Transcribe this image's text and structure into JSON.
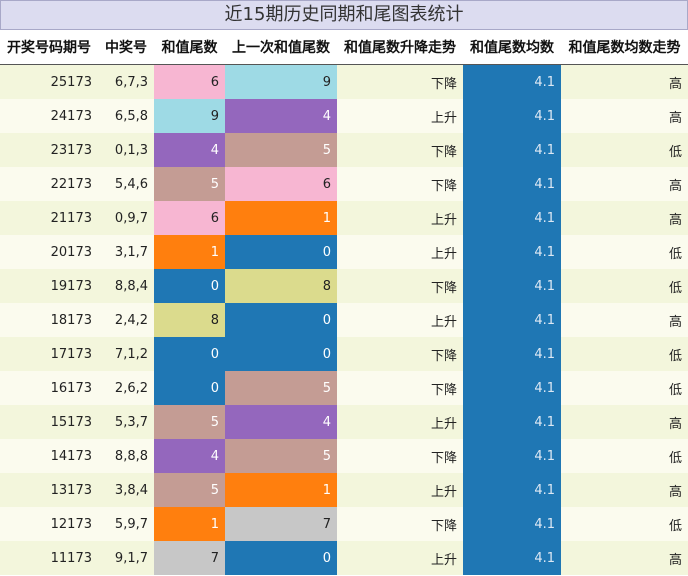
{
  "title": "近15期历史同期和尾图表统计",
  "headers": [
    "开奖号码期号",
    "中奖号",
    "和值尾数",
    "上一次和值尾数",
    "和值尾数升降走势",
    "和值尾数均数",
    "和值尾数均数走势"
  ],
  "colors": {
    "0": "#1f77b4",
    "1": "#ff7f0e",
    "4": "#9467bd",
    "5": "#c49c94",
    "6": "#f7b6d2",
    "7": "#c7c7c7",
    "8": "#dbdb8d",
    "9": "#9edae5",
    "avg": "#1f77b4"
  },
  "rows": [
    {
      "period": "25173",
      "numbers": "6,7,3",
      "tail": "6",
      "prev_tail": "9",
      "trend": "下降",
      "avg": "4.1",
      "avg_trend": "高"
    },
    {
      "period": "24173",
      "numbers": "6,5,8",
      "tail": "9",
      "prev_tail": "4",
      "trend": "上升",
      "avg": "4.1",
      "avg_trend": "高"
    },
    {
      "period": "23173",
      "numbers": "0,1,3",
      "tail": "4",
      "prev_tail": "5",
      "trend": "下降",
      "avg": "4.1",
      "avg_trend": "低"
    },
    {
      "period": "22173",
      "numbers": "5,4,6",
      "tail": "5",
      "prev_tail": "6",
      "trend": "下降",
      "avg": "4.1",
      "avg_trend": "高"
    },
    {
      "period": "21173",
      "numbers": "0,9,7",
      "tail": "6",
      "prev_tail": "1",
      "trend": "上升",
      "avg": "4.1",
      "avg_trend": "高"
    },
    {
      "period": "20173",
      "numbers": "3,1,7",
      "tail": "1",
      "prev_tail": "0",
      "trend": "上升",
      "avg": "4.1",
      "avg_trend": "低"
    },
    {
      "period": "19173",
      "numbers": "8,8,4",
      "tail": "0",
      "prev_tail": "8",
      "trend": "下降",
      "avg": "4.1",
      "avg_trend": "低"
    },
    {
      "period": "18173",
      "numbers": "2,4,2",
      "tail": "8",
      "prev_tail": "0",
      "trend": "上升",
      "avg": "4.1",
      "avg_trend": "高"
    },
    {
      "period": "17173",
      "numbers": "7,1,2",
      "tail": "0",
      "prev_tail": "0",
      "trend": "下降",
      "avg": "4.1",
      "avg_trend": "低"
    },
    {
      "period": "16173",
      "numbers": "2,6,2",
      "tail": "0",
      "prev_tail": "5",
      "trend": "下降",
      "avg": "4.1",
      "avg_trend": "低"
    },
    {
      "period": "15173",
      "numbers": "5,3,7",
      "tail": "5",
      "prev_tail": "4",
      "trend": "上升",
      "avg": "4.1",
      "avg_trend": "高"
    },
    {
      "period": "14173",
      "numbers": "8,8,8",
      "tail": "4",
      "prev_tail": "5",
      "trend": "下降",
      "avg": "4.1",
      "avg_trend": "低"
    },
    {
      "period": "13173",
      "numbers": "3,8,4",
      "tail": "5",
      "prev_tail": "1",
      "trend": "上升",
      "avg": "4.1",
      "avg_trend": "高"
    },
    {
      "period": "12173",
      "numbers": "5,9,7",
      "tail": "1",
      "prev_tail": "7",
      "trend": "下降",
      "avg": "4.1",
      "avg_trend": "低"
    },
    {
      "period": "11173",
      "numbers": "9,1,7",
      "tail": "7",
      "prev_tail": "0",
      "trend": "上升",
      "avg": "4.1",
      "avg_trend": "高"
    }
  ]
}
